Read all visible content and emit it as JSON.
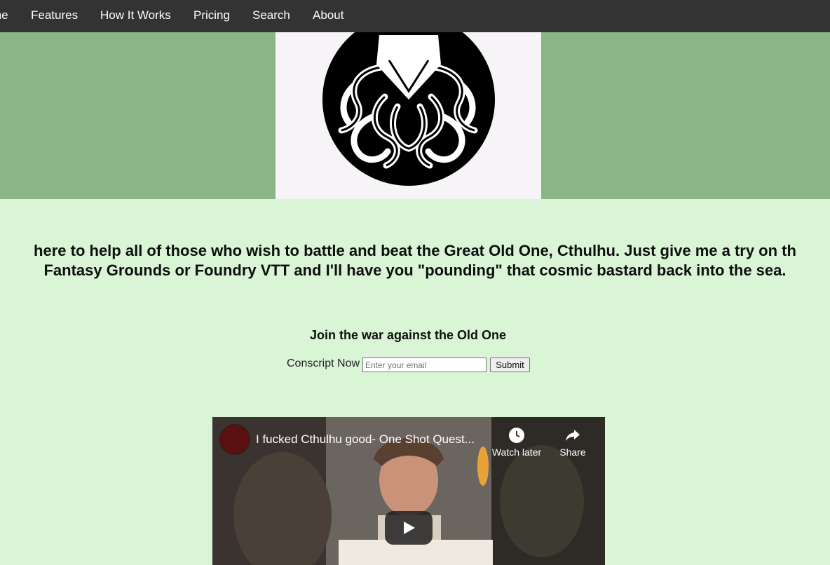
{
  "nav": {
    "items": [
      "me",
      "Features",
      "How It Works",
      "Pricing",
      "Search",
      "About"
    ]
  },
  "tagline": {
    "line1": "here to help all of those who wish to battle and beat the Great Old One, Cthulhu. Just give me a try on th",
    "line2": "Fantasy Grounds or Foundry VTT and I'll have you \"pounding\" that cosmic bastard back into the sea."
  },
  "signup": {
    "heading": "Join the war against the Old One",
    "label": "Conscript Now",
    "email_placeholder": "Enter your email",
    "submit_label": "Submit"
  },
  "video": {
    "title": "I fucked Cthulhu good- One Shot Quest...",
    "watch_later_label": "Watch later",
    "share_label": "Share"
  },
  "colors": {
    "nav_bg": "#333333",
    "hero_bg": "#89b587",
    "page_bg": "#d9f5d6"
  }
}
